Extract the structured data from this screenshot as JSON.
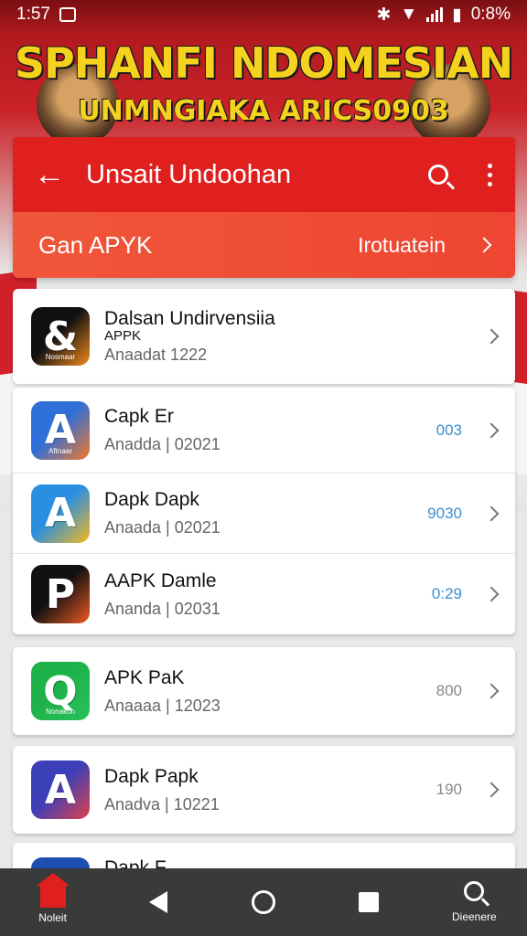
{
  "status_bar": {
    "time": "1:57",
    "battery": "0:8%"
  },
  "banner": {
    "headline": "SPHANFI NDOMESIAN",
    "subline": "UNMNGIAKA ARICS0903"
  },
  "app_bar": {
    "title": "Unsait Undoohan"
  },
  "sub_bar": {
    "label": "Gan APYK",
    "category": "Irotuatein"
  },
  "apps": [
    {
      "name": "Dalsan Undirvensiia",
      "sub": "APPK",
      "meta": "Anaadat 1222",
      "value": "",
      "icon_text": "Nosmaar",
      "colors": [
        "#111111",
        "#f28b1e"
      ]
    },
    {
      "name": "Capk Er",
      "sub": "",
      "meta": "Anadda | 02021",
      "value": "003",
      "icon_text": "Aftnaar",
      "colors": [
        "#2f6fd8",
        "#f2782a"
      ]
    },
    {
      "name": "Dapk Dapk",
      "sub": "",
      "meta": "Anaada | 02021",
      "value": "9030",
      "icon_text": "",
      "colors": [
        "#2a8fe0",
        "#f7b71d"
      ]
    },
    {
      "name": "AAPK Damle",
      "sub": "",
      "meta": "Ananda | 02031",
      "value": "0:29",
      "icon_text": "",
      "colors": [
        "#111111",
        "#f05a23"
      ]
    },
    {
      "name": "APK PaK",
      "sub": "",
      "meta": "Anaaaa | 12023",
      "value": "800",
      "icon_text": "Nonakon",
      "colors": [
        "#1fb24a",
        "#27c25a"
      ]
    },
    {
      "name": "Dapk Papk",
      "sub": "",
      "meta": "Anadva | 10221",
      "value": "190",
      "icon_text": "",
      "colors": [
        "#3b3fb8",
        "#e0404a"
      ]
    },
    {
      "name": "Dapk F",
      "sub": "",
      "meta": "",
      "value": "",
      "icon_text": "",
      "colors": [
        "#1d4fb0",
        "#1d4fb0"
      ]
    }
  ],
  "nav_bar": {
    "home_label": "Noleit",
    "search_label": "Dieenere"
  }
}
